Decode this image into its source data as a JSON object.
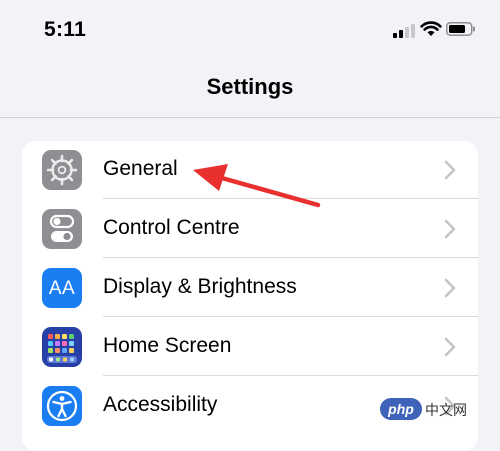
{
  "status_bar": {
    "time": "5:11",
    "icons": [
      "cellular-signal-icon",
      "wifi-icon",
      "battery-icon"
    ]
  },
  "nav": {
    "title": "Settings"
  },
  "settings": {
    "items": [
      {
        "label": "General",
        "icon": "gear-icon",
        "icon_color": "#8e8e93"
      },
      {
        "label": "Control Centre",
        "icon": "toggles-icon",
        "icon_color": "#8e8e93"
      },
      {
        "label": "Display & Brightness",
        "icon": "text-size-icon",
        "icon_color": "#1a7ef2",
        "icon_text": "AA"
      },
      {
        "label": "Home Screen",
        "icon": "app-grid-icon",
        "icon_color": "#2740a8"
      },
      {
        "label": "Accessibility",
        "icon": "accessibility-icon",
        "icon_color": "#1a7ef2"
      }
    ]
  },
  "annotation": {
    "color": "#e8302f",
    "target": "General"
  },
  "watermark": {
    "logo": "php",
    "text": "中文网"
  },
  "colors": {
    "background": "#f2f2f7",
    "card": "#ffffff",
    "chevron": "#c4c4c7",
    "accent_blue": "#1a7ef2"
  }
}
